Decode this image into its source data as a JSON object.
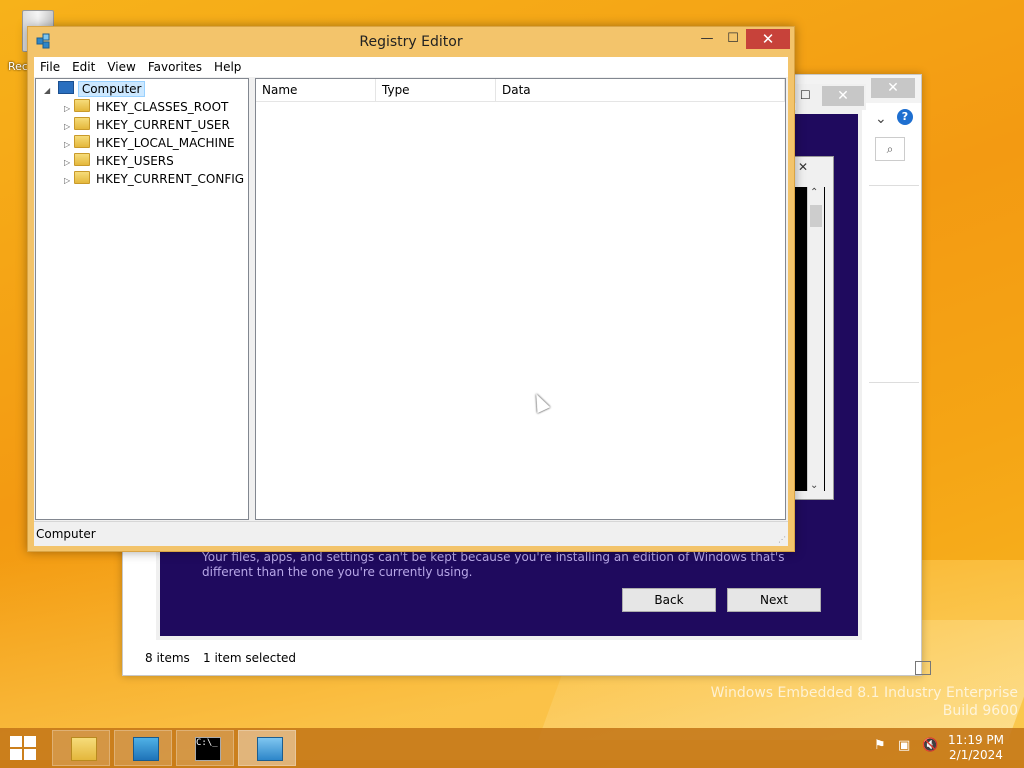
{
  "desktop": {
    "recycle_bin_label": "Rec",
    "watermark_line1": "Windows Embedded 8.1 Industry Enterprise",
    "watermark_line2": "Build 9600"
  },
  "explorer": {
    "item_count": "8 items",
    "selection": "1 item selected",
    "close_label": "✕",
    "search_icon": "⌕",
    "help_icon": "?",
    "chevron_icon": "⌄"
  },
  "setup": {
    "message": "Your files, apps, and settings can't be kept because you're installing an edition of Windows that's different than the one you're currently using.",
    "back_label": "Back",
    "next_label": "Next",
    "close_label": "✕",
    "max_label": "☐"
  },
  "eula": {
    "close_label": "✕",
    "up_arrow": "⌃",
    "down_arrow": "⌄"
  },
  "regedit": {
    "title": "Registry Editor",
    "min_label": "—",
    "max_label": "☐",
    "close_label": "✕",
    "menu": [
      "File",
      "Edit",
      "View",
      "Favorites",
      "Help"
    ],
    "tree_root": "Computer",
    "tree_items": [
      "HKEY_CLASSES_ROOT",
      "HKEY_CURRENT_USER",
      "HKEY_LOCAL_MACHINE",
      "HKEY_USERS",
      "HKEY_CURRENT_CONFIG"
    ],
    "columns": [
      "Name",
      "Type",
      "Data"
    ],
    "status": "Computer",
    "expand_glyph": "▷",
    "collapse_glyph": "◢"
  },
  "taskbar": {
    "time": "11:19 PM",
    "date": "2/1/2024",
    "cmd_glyph": "C:\\_"
  }
}
